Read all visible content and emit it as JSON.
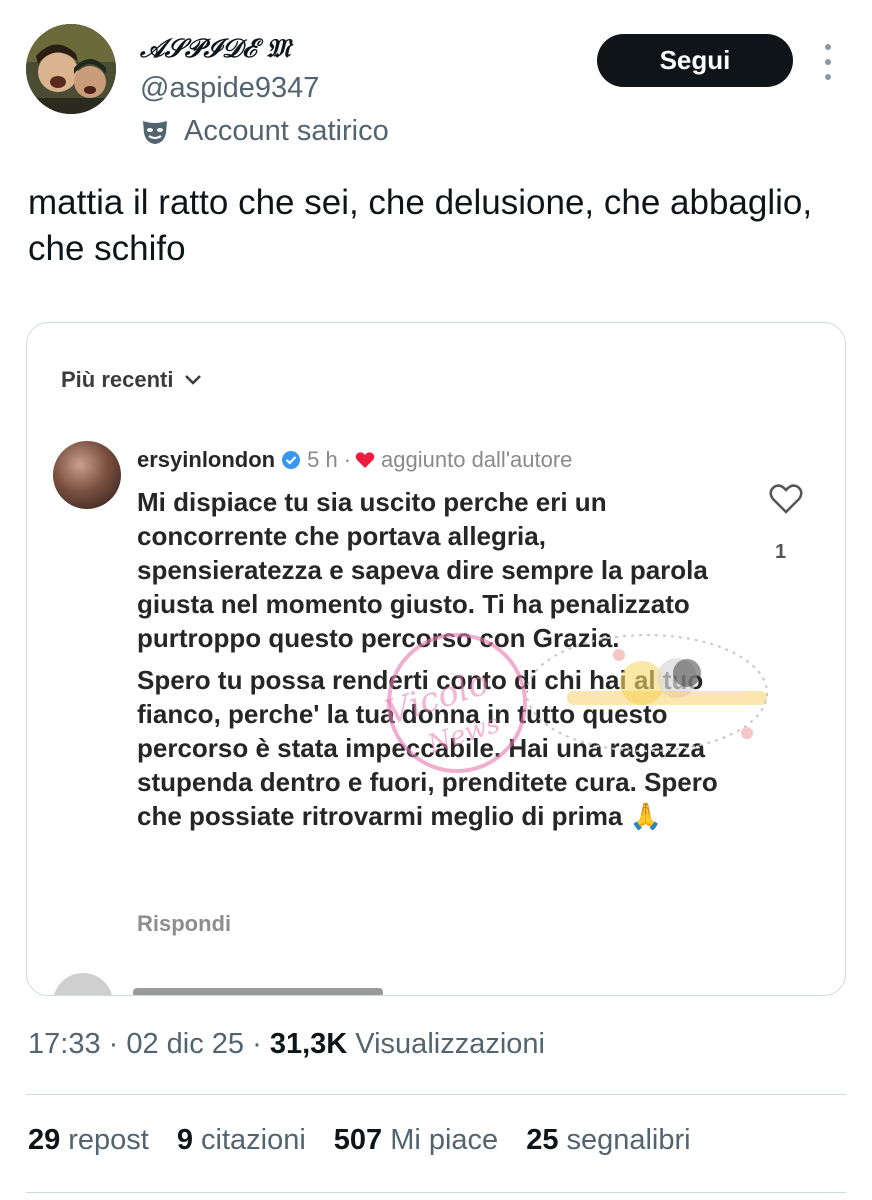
{
  "author": {
    "display_name": "𝒜𝒮𝒫ℐ𝒟ℰ 𝔐",
    "handle": "@aspide9347",
    "badge_label": "Account satirico",
    "badge_icon": "theater-mask-icon"
  },
  "follow_button": {
    "label": "Segui"
  },
  "more_icon": "more-vertical-icon",
  "tweet": {
    "text": "mattia il ratto che sei, che delusione, che abbaglio, che schifo"
  },
  "embedded_screenshot": {
    "sort_label": "Più recenti",
    "comment": {
      "username": "ersyinlondon",
      "time": "5 h",
      "separator": "·",
      "tag": "aggiunto dall'autore",
      "paragraph_1": "Mi dispiace tu sia uscito perche eri un concorrente che portava allegria, spensieratezza e sapeva dire sempre la parola giusta nel momento giusto. Ti ha penalizzato purtroppo questo percorso con Grazia.",
      "paragraph_2": "Spero tu possa renderti conto di chi hai al tuo fianco, perche' la tua donna in tutto questo percorso è stata impeccabile. Hai una ragazza stupenda dentro e fuori, prenditete cura. Spero che possiate ritrovarmi meglio di prima 🙏",
      "reply_label": "Rispondi",
      "like_count": "1"
    },
    "watermark_text": "Vicolo delle News"
  },
  "meta": {
    "time": "17:33",
    "sep1": " · ",
    "date": "02 dic 25",
    "sep2": " · ",
    "views_count": "31,3K",
    "views_label": "Visualizzazioni"
  },
  "stats": {
    "reposts_count": "29",
    "reposts_label": "repost",
    "quotes_count": "9",
    "quotes_label": "citazioni",
    "likes_count": "507",
    "likes_label": "Mi piace",
    "bookmarks_count": "25",
    "bookmarks_label": "segnalibri"
  },
  "colors": {
    "text": "#0f1419",
    "secondary": "#536471",
    "border": "#cfd9de",
    "follow_bg": "#0f1419",
    "verified": "#3897f0",
    "heart": "#ed1c3e"
  }
}
